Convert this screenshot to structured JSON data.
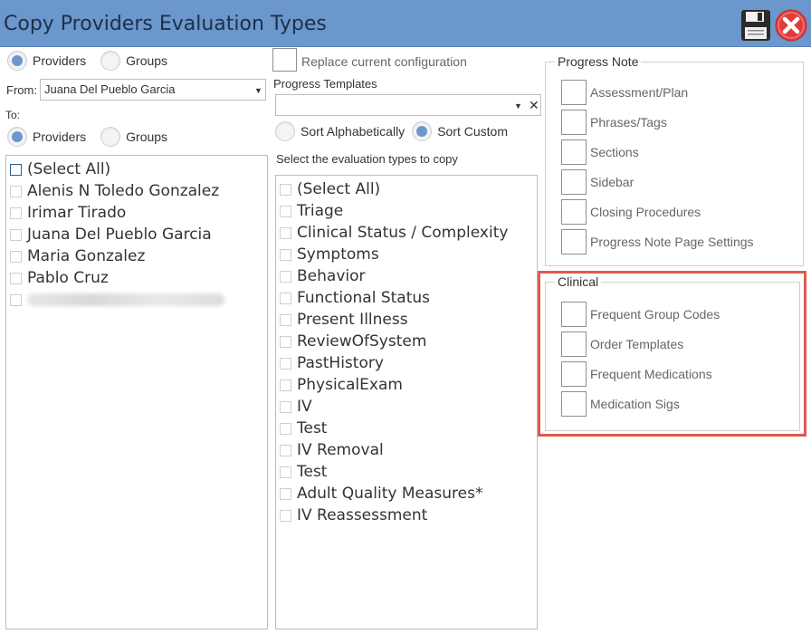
{
  "window": {
    "title": "Copy Providers Evaluation Types"
  },
  "source": {
    "radios": [
      {
        "label": "Providers",
        "selected": true
      },
      {
        "label": "Groups",
        "selected": false
      }
    ],
    "from_label": "From:",
    "from_value": "Juana Del Pueblo Garcia"
  },
  "to": {
    "label": "To:",
    "radios": [
      {
        "label": "Providers",
        "selected": true
      },
      {
        "label": "Groups",
        "selected": false
      }
    ],
    "items": [
      "(Select All)",
      "Alenis N Toledo Gonzalez",
      "Irimar Tirado",
      "Juana Del Pueblo Garcia",
      "Maria Gonzalez",
      "Pablo Cruz"
    ]
  },
  "middle": {
    "replace_label": "Replace current configuration",
    "templates_label": "Progress Templates",
    "templates_value": "",
    "sort": [
      {
        "label": "Sort Alphabetically",
        "selected": false
      },
      {
        "label": "Sort Custom",
        "selected": true
      }
    ],
    "select_label": "Select the evaluation types to copy",
    "eval_types": [
      "(Select All)",
      "Triage",
      "Clinical Status / Complexity",
      "Symptoms",
      "Behavior",
      "Functional Status",
      "Present Illness",
      "ReviewOfSystem",
      "PastHistory",
      "PhysicalExam",
      "IV",
      "Test",
      "IV Removal",
      "Test",
      "Adult Quality Measures*",
      "IV Reassessment"
    ]
  },
  "progress_note": {
    "legend": "Progress Note",
    "items": [
      "Assessment/Plan",
      "Phrases/Tags",
      "Sections",
      "Sidebar",
      "Closing Procedures",
      "Progress Note Page Settings"
    ]
  },
  "clinical": {
    "legend": "Clinical",
    "items": [
      "Frequent Group Codes",
      "Order Templates",
      "Frequent Medications",
      "Medication Sigs"
    ]
  },
  "colors": {
    "titlebar": "#6b97cc",
    "highlight": "#e2584f",
    "radio_selected": "#6b97cc"
  },
  "icons": {
    "save": "floppy-disk-icon",
    "close": "close-icon"
  }
}
